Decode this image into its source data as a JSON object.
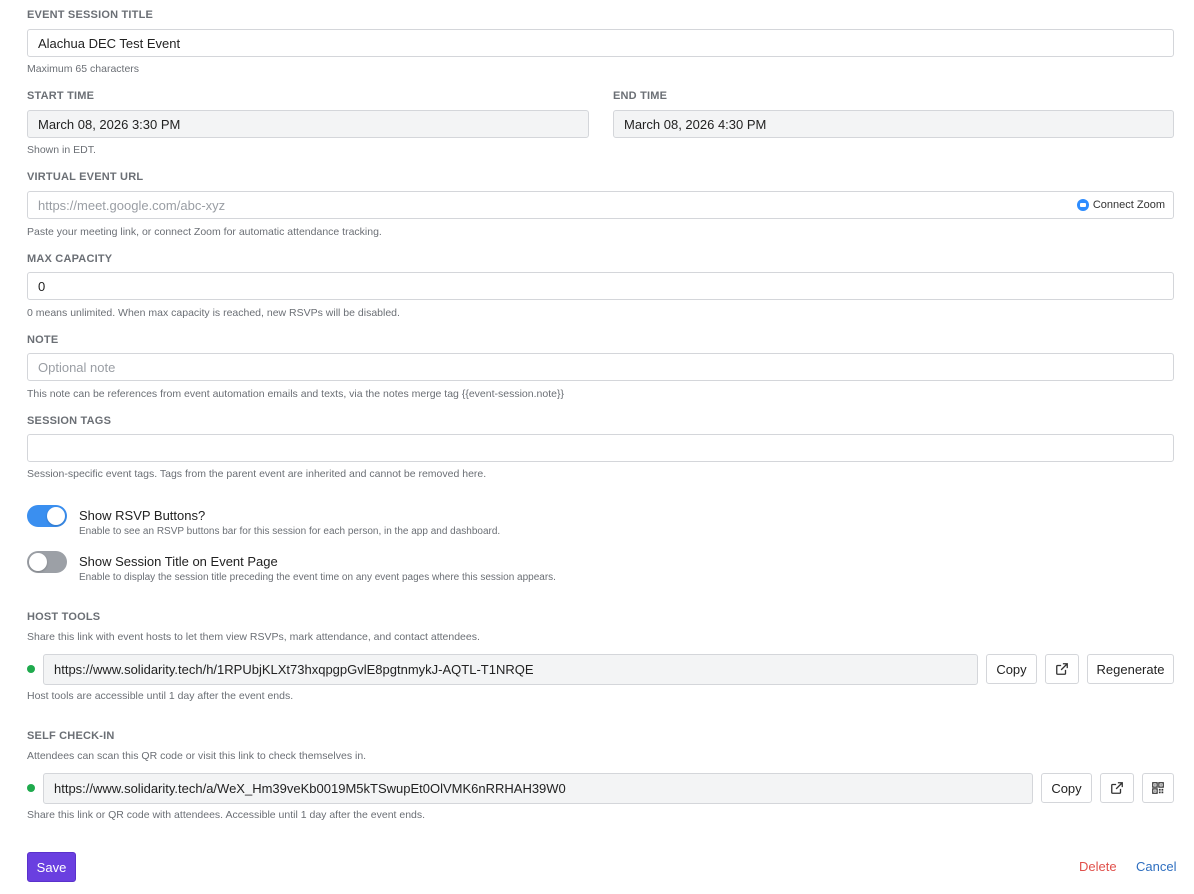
{
  "title_section": {
    "label": "EVENT SESSION TITLE",
    "value": "Alachua DEC Test Event",
    "help": "Maximum 65 characters"
  },
  "start_time": {
    "label": "START TIME",
    "value": "March 08, 2026 3:30 PM",
    "help": "Shown in EDT."
  },
  "end_time": {
    "label": "END TIME",
    "value": "March 08, 2026 4:30 PM"
  },
  "virtual_url": {
    "label": "VIRTUAL EVENT URL",
    "placeholder": "https://meet.google.com/abc-xyz",
    "connect_label": "Connect Zoom",
    "help": "Paste your meeting link, or connect Zoom for automatic attendance tracking."
  },
  "max_capacity": {
    "label": "MAX CAPACITY",
    "value": "0",
    "help": "0 means unlimited. When max capacity is reached, new RSVPs will be disabled."
  },
  "note": {
    "label": "NOTE",
    "placeholder": "Optional note",
    "help": "This note can be references from event automation emails and texts, via the notes merge tag {{event-session.note}}"
  },
  "session_tags": {
    "label": "SESSION TAGS",
    "value": "",
    "help": "Session-specific event tags. Tags from the parent event are inherited and cannot be removed here."
  },
  "toggles": [
    {
      "title": "Show RSVP Buttons?",
      "subtitle": "Enable to see an RSVP buttons bar for this session for each person, in the app and dashboard.",
      "on": true
    },
    {
      "title": "Show Session Title on Event Page",
      "subtitle": "Enable to display the session title preceding the event time on any event pages where this session appears.",
      "on": false
    }
  ],
  "host_tools": {
    "label": "HOST TOOLS",
    "description": "Share this link with event hosts to let them view RSVPs, mark attendance, and contact attendees.",
    "url": "https://www.solidarity.tech/h/1RPUbjKLXt73hxqpgpGvlE8pgtnmykJ-AQTL-T1NRQE",
    "copy_label": "Copy",
    "regenerate_label": "Regenerate",
    "help": "Host tools are accessible until 1 day after the event ends."
  },
  "self_checkin": {
    "label": "SELF CHECK-IN",
    "description": "Attendees can scan this QR code or visit this link to check themselves in.",
    "url": "https://www.solidarity.tech/a/WeX_Hm39veKb0019M5kTSwupEt0OlVMK6nRRHAH39W0",
    "copy_label": "Copy",
    "help": "Share this link or QR code with attendees. Accessible until 1 day after the event ends."
  },
  "actions": {
    "save": "Save",
    "delete": "Delete",
    "cancel": "Cancel"
  },
  "colors": {
    "primary": "#6a3fe0",
    "toggle_on": "#3a8ff0",
    "status_dot": "#1faa4d",
    "delete": "#e0504b",
    "cancel": "#2f6fc0"
  }
}
